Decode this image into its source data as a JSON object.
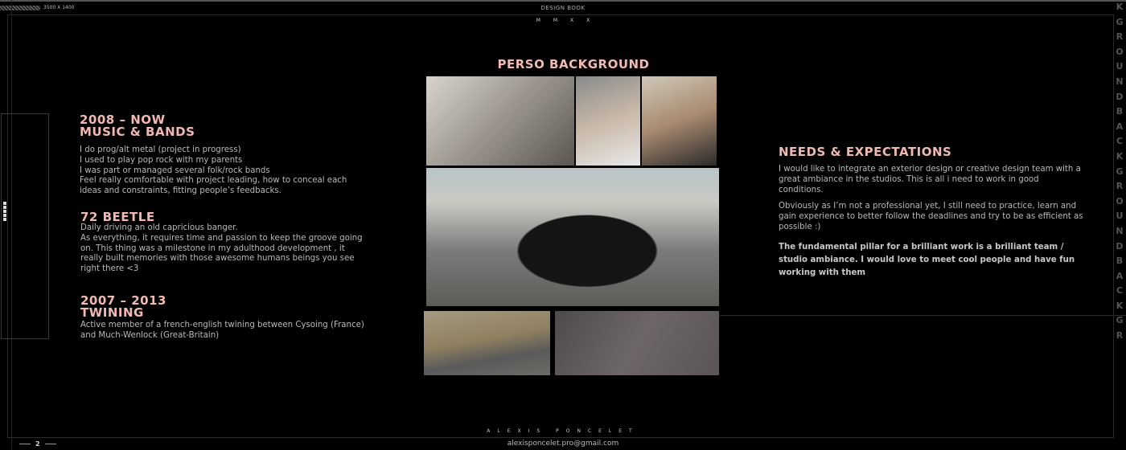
{
  "header": {
    "resolution": "3500 X 1400",
    "title": "DESIGN BOOK",
    "year": "MMXX"
  },
  "left": {
    "sections": [
      {
        "title_line1": "2008 – NOW",
        "title_line2": "MUSIC & BANDS",
        "lines": [
          "I do prog/alt metal (project in progress)",
          "I used to play pop rock with my parents",
          "I was part or managed several folk/rock bands",
          "Feel really comfortable with project leading, how to conceal each ideas and constraints, fitting people’s feedbacks."
        ]
      },
      {
        "title_line1": "72 BEETLE",
        "lines": [
          "Daily driving an old capricious banger.",
          "As everything, it requires time and passion to keep the groove going on. This thing was a milestone in my adulthood development , it really built memories with those awesome humans beings you see right there <3"
        ]
      },
      {
        "title_line1": "2007 – 2013",
        "title_line2": "TWINING",
        "lines": [
          "Active member of a french-english twining between Cysoing (France) and Much-Wenlock (Great-Britain)"
        ]
      }
    ]
  },
  "center": {
    "title": "PERSO BACKGROUND",
    "photos": [
      "friends-room-photo",
      "group-photo",
      "group-photo-right",
      "beetle-gas-station-photo",
      "beetle-road-photo",
      "guitar-photo"
    ]
  },
  "right": {
    "title": "NEEDS & EXPECTATIONS",
    "p1": "I would like to integrate an exterior design or creative design team with a great ambiance in the studios. This is all i need to work in good conditions.",
    "p2": "Obviously as I’m not a professional yet, I still need to practice, learn and gain experience to better follow the deadlines and try to be as efficient as possible :)",
    "p3": "The fundamental pillar for a brilliant work is a brilliant team / studio ambiance. I would love to meet cool people and have fun working with them"
  },
  "side_text": "KGROUND BACKGROUND BACKGR",
  "footer": {
    "name": "ALEXIS PONCELET",
    "email": "alexisponcelet.pro@gmail.com",
    "page": "2"
  },
  "colors": {
    "accent": "#f2b9b3",
    "background": "#000000",
    "text": "#b9b9b9"
  }
}
